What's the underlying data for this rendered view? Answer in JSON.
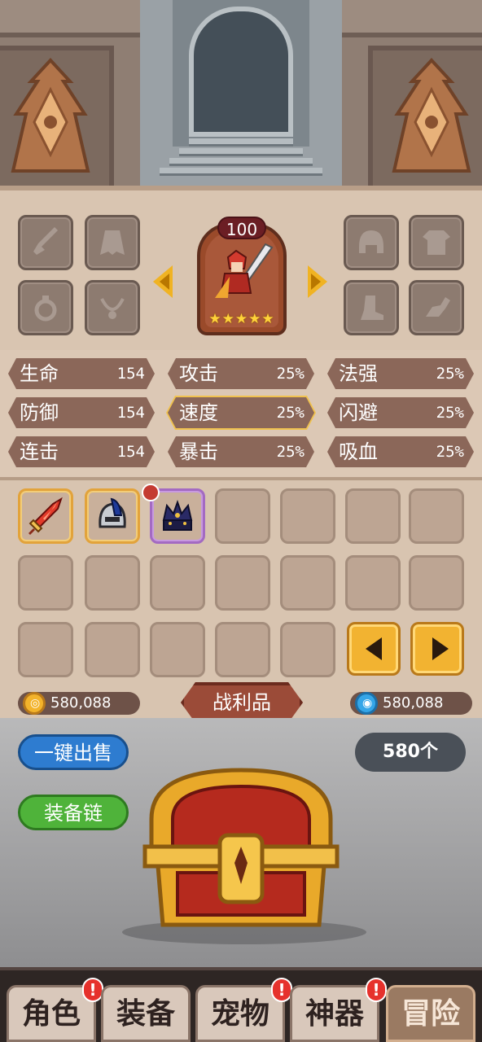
{
  "character": {
    "level": "100",
    "stars": "★★★★★",
    "left_slots": [
      {
        "icon": "sword-slot-icon"
      },
      {
        "icon": "cape-slot-icon"
      },
      {
        "icon": "ring-slot-icon"
      },
      {
        "icon": "necklace-slot-icon"
      }
    ],
    "right_slots": [
      {
        "icon": "helmet-slot-icon"
      },
      {
        "icon": "armor-slot-icon"
      },
      {
        "icon": "boots-slot-icon"
      },
      {
        "icon": "pet-slot-icon"
      }
    ]
  },
  "stats": [
    {
      "name": "生命",
      "value": "154"
    },
    {
      "name": "攻击",
      "value": "25%"
    },
    {
      "name": "法强",
      "value": "25%"
    },
    {
      "name": "防御",
      "value": "154"
    },
    {
      "name": "速度",
      "value": "25%"
    },
    {
      "name": "闪避",
      "value": "25%"
    },
    {
      "name": "连击",
      "value": "154"
    },
    {
      "name": "暴击",
      "value": "25%"
    },
    {
      "name": "吸血",
      "value": "25%"
    }
  ],
  "inventory": {
    "items": [
      "red-sword-item",
      "blue-helmet-item",
      "dark-crown-item"
    ]
  },
  "currency": {
    "gold": "580,088",
    "gems": "580,088",
    "gold_symbol": "◎",
    "gem_symbol": "◉"
  },
  "loot": {
    "title": "战利品",
    "sell_all": "一键出售",
    "equip_chain": "装备链",
    "count": "580个"
  },
  "nav": {
    "tabs": [
      {
        "label": "角色",
        "alert": "!"
      },
      {
        "label": "装备",
        "alert": ""
      },
      {
        "label": "宠物",
        "alert": "!"
      },
      {
        "label": "神器",
        "alert": "!"
      },
      {
        "label": "冒险",
        "alert": ""
      }
    ]
  },
  "colors": {
    "panel": "#d9c5b1",
    "stat_bg": "#8b6759",
    "gold": "#f2b331",
    "sell_blue": "#2e7cd0",
    "chain_green": "#4fb33a",
    "alert_red": "#e6312c"
  }
}
